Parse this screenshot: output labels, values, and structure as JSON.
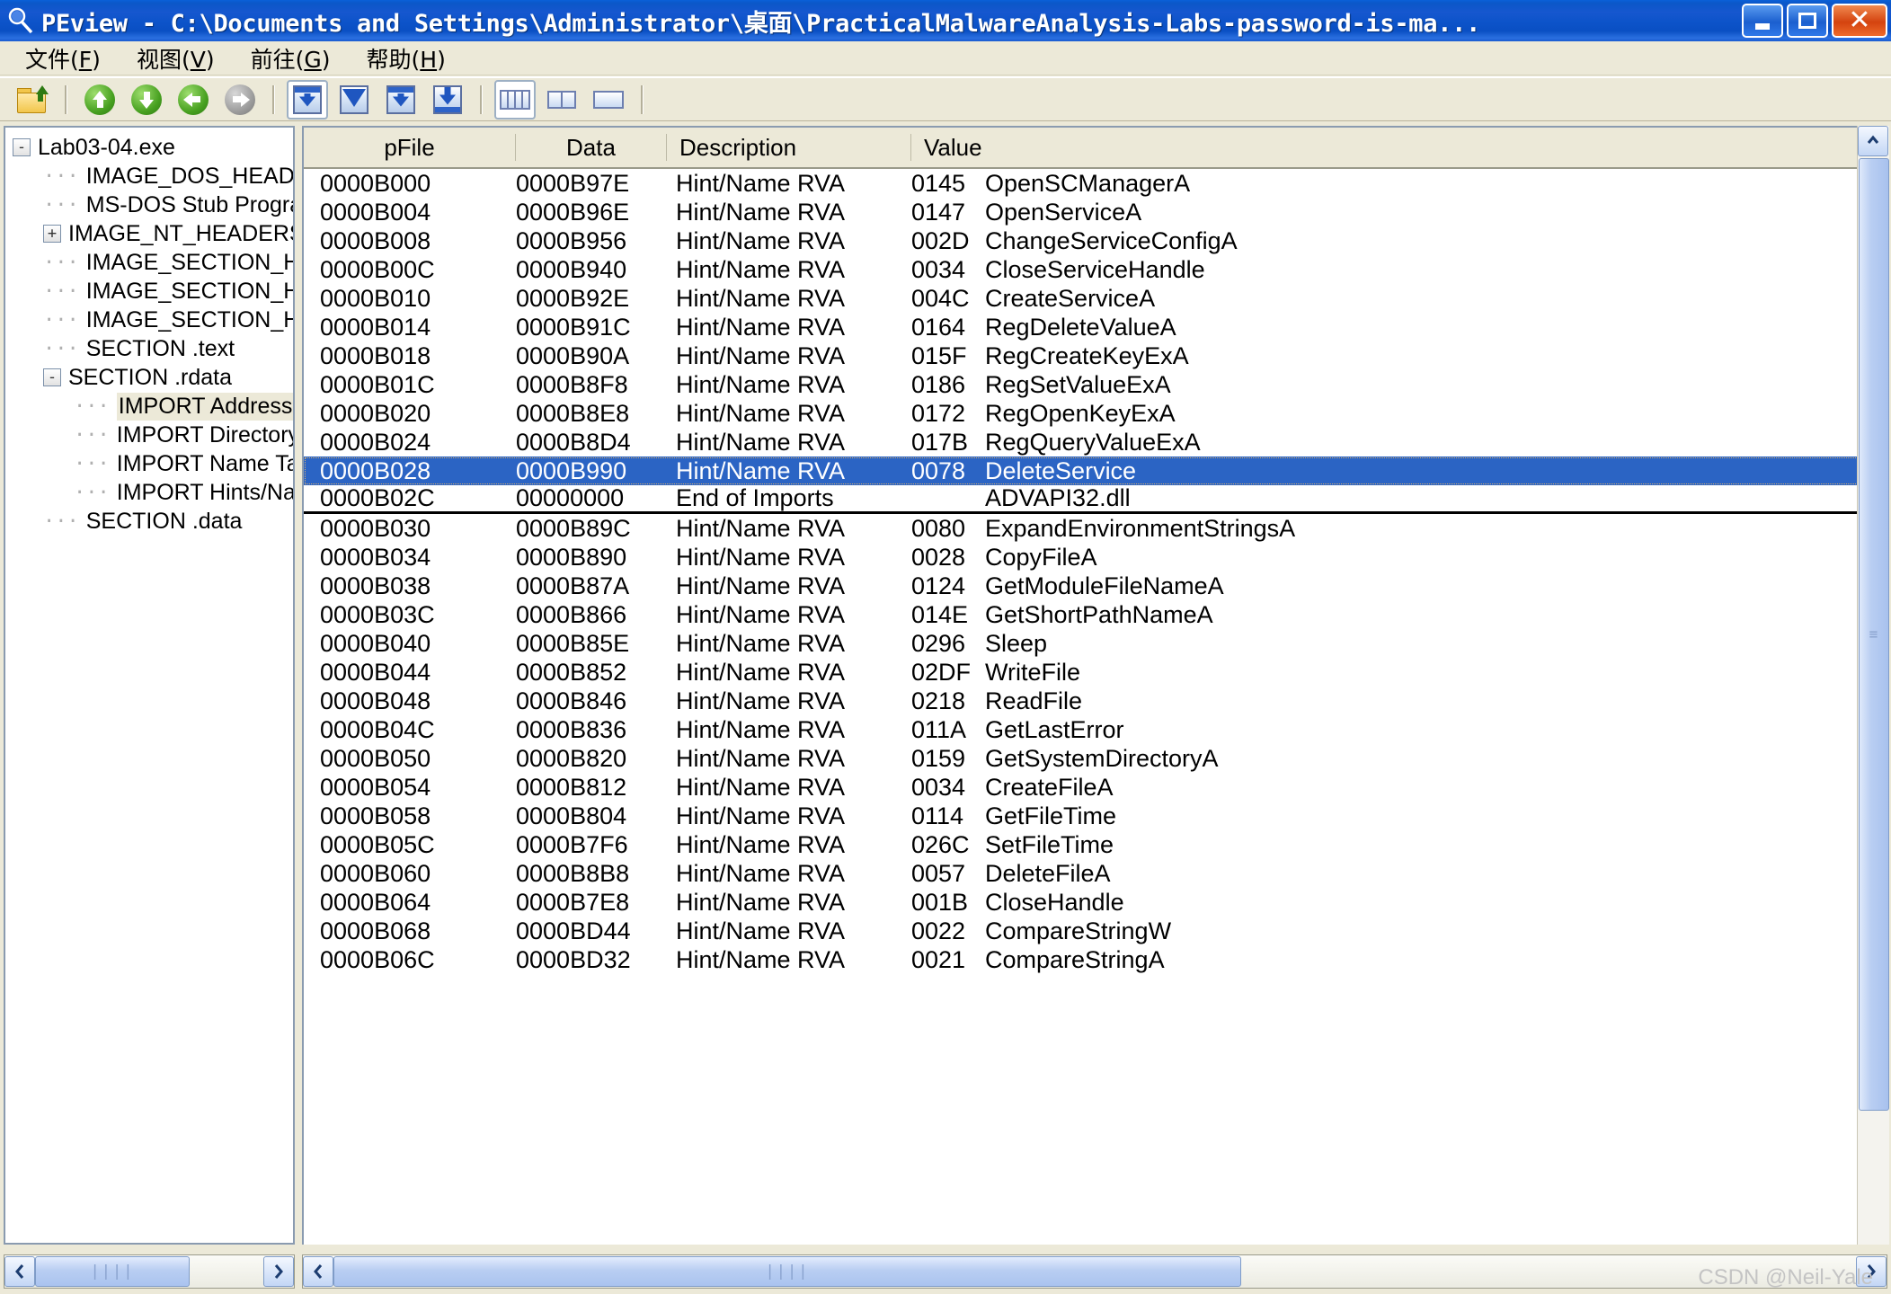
{
  "window": {
    "title": "PEview - C:\\Documents and Settings\\Administrator\\桌面\\PracticalMalwareAnalysis-Labs-password-is-ma...",
    "icon": "magnifier-icon",
    "buttons": {
      "minimize": "_",
      "maximize": "□",
      "close": "✕"
    }
  },
  "menu": {
    "items": [
      {
        "label": "文件",
        "mnemonic": "F"
      },
      {
        "label": "视图",
        "mnemonic": "V"
      },
      {
        "label": "前往",
        "mnemonic": "G"
      },
      {
        "label": "帮助",
        "mnemonic": "H"
      }
    ]
  },
  "toolbar": {
    "buttons": [
      {
        "name": "open-file-icon"
      },
      {
        "name": "go-up-icon"
      },
      {
        "name": "go-down-icon"
      },
      {
        "name": "go-back-icon"
      },
      {
        "name": "go-forward-icon"
      },
      {
        "name": "view-first-icon"
      },
      {
        "name": "view-next-icon"
      },
      {
        "name": "view-prev-icon"
      },
      {
        "name": "view-last-icon"
      },
      {
        "name": "layout-columns-icon"
      },
      {
        "name": "layout-two-pane-icon"
      },
      {
        "name": "layout-single-pane-icon"
      }
    ]
  },
  "tree": {
    "root": {
      "label": "Lab03-04.exe",
      "toggle": "-"
    },
    "items": [
      {
        "label": "IMAGE_DOS_HEADER",
        "toggle": "",
        "indent": 1,
        "selected": false
      },
      {
        "label": "MS-DOS Stub Program",
        "toggle": "",
        "indent": 1,
        "selected": false
      },
      {
        "label": "IMAGE_NT_HEADERS",
        "toggle": "+",
        "indent": 1,
        "selected": false
      },
      {
        "label": "IMAGE_SECTION_HEAI",
        "toggle": "",
        "indent": 1,
        "selected": false
      },
      {
        "label": "IMAGE_SECTION_HEAI",
        "toggle": "",
        "indent": 1,
        "selected": false
      },
      {
        "label": "IMAGE_SECTION_HEAI",
        "toggle": "",
        "indent": 1,
        "selected": false
      },
      {
        "label": "SECTION .text",
        "toggle": "",
        "indent": 1,
        "selected": false
      },
      {
        "label": "SECTION .rdata",
        "toggle": "-",
        "indent": 1,
        "selected": false
      },
      {
        "label": "IMPORT Address Tab",
        "toggle": "",
        "indent": 2,
        "selected": true
      },
      {
        "label": "IMPORT Directory Ta",
        "toggle": "",
        "indent": 2,
        "selected": false
      },
      {
        "label": "IMPORT Name Table",
        "toggle": "",
        "indent": 2,
        "selected": false
      },
      {
        "label": "IMPORT Hints/Name",
        "toggle": "",
        "indent": 2,
        "selected": false
      },
      {
        "label": "SECTION .data",
        "toggle": "",
        "indent": 1,
        "selected": false
      }
    ]
  },
  "table": {
    "columns": [
      "pFile",
      "Data",
      "Description",
      "Value"
    ],
    "rows": [
      {
        "pFile": "0000B000",
        "data": "0000B97E",
        "description": "Hint/Name RVA",
        "hint": "0145",
        "name": "OpenSCManagerA",
        "selected": false,
        "end": false
      },
      {
        "pFile": "0000B004",
        "data": "0000B96E",
        "description": "Hint/Name RVA",
        "hint": "0147",
        "name": "OpenServiceA",
        "selected": false,
        "end": false
      },
      {
        "pFile": "0000B008",
        "data": "0000B956",
        "description": "Hint/Name RVA",
        "hint": "002D",
        "name": "ChangeServiceConfigA",
        "selected": false,
        "end": false
      },
      {
        "pFile": "0000B00C",
        "data": "0000B940",
        "description": "Hint/Name RVA",
        "hint": "0034",
        "name": "CloseServiceHandle",
        "selected": false,
        "end": false
      },
      {
        "pFile": "0000B010",
        "data": "0000B92E",
        "description": "Hint/Name RVA",
        "hint": "004C",
        "name": "CreateServiceA",
        "selected": false,
        "end": false
      },
      {
        "pFile": "0000B014",
        "data": "0000B91C",
        "description": "Hint/Name RVA",
        "hint": "0164",
        "name": "RegDeleteValueA",
        "selected": false,
        "end": false
      },
      {
        "pFile": "0000B018",
        "data": "0000B90A",
        "description": "Hint/Name RVA",
        "hint": "015F",
        "name": "RegCreateKeyExA",
        "selected": false,
        "end": false
      },
      {
        "pFile": "0000B01C",
        "data": "0000B8F8",
        "description": "Hint/Name RVA",
        "hint": "0186",
        "name": "RegSetValueExA",
        "selected": false,
        "end": false
      },
      {
        "pFile": "0000B020",
        "data": "0000B8E8",
        "description": "Hint/Name RVA",
        "hint": "0172",
        "name": "RegOpenKeyExA",
        "selected": false,
        "end": false
      },
      {
        "pFile": "0000B024",
        "data": "0000B8D4",
        "description": "Hint/Name RVA",
        "hint": "017B",
        "name": "RegQueryValueExA",
        "selected": false,
        "end": false
      },
      {
        "pFile": "0000B028",
        "data": "0000B990",
        "description": "Hint/Name RVA",
        "hint": "0078",
        "name": "DeleteService",
        "selected": true,
        "end": false
      },
      {
        "pFile": "0000B02C",
        "data": "00000000",
        "description": "End of Imports",
        "hint": "",
        "name": "ADVAPI32.dll",
        "selected": false,
        "end": true
      },
      {
        "pFile": "0000B030",
        "data": "0000B89C",
        "description": "Hint/Name RVA",
        "hint": "0080",
        "name": "ExpandEnvironmentStringsA",
        "selected": false,
        "end": false
      },
      {
        "pFile": "0000B034",
        "data": "0000B890",
        "description": "Hint/Name RVA",
        "hint": "0028",
        "name": "CopyFileA",
        "selected": false,
        "end": false
      },
      {
        "pFile": "0000B038",
        "data": "0000B87A",
        "description": "Hint/Name RVA",
        "hint": "0124",
        "name": "GetModuleFileNameA",
        "selected": false,
        "end": false
      },
      {
        "pFile": "0000B03C",
        "data": "0000B866",
        "description": "Hint/Name RVA",
        "hint": "014E",
        "name": "GetShortPathNameA",
        "selected": false,
        "end": false
      },
      {
        "pFile": "0000B040",
        "data": "0000B85E",
        "description": "Hint/Name RVA",
        "hint": "0296",
        "name": "Sleep",
        "selected": false,
        "end": false
      },
      {
        "pFile": "0000B044",
        "data": "0000B852",
        "description": "Hint/Name RVA",
        "hint": "02DF",
        "name": "WriteFile",
        "selected": false,
        "end": false
      },
      {
        "pFile": "0000B048",
        "data": "0000B846",
        "description": "Hint/Name RVA",
        "hint": "0218",
        "name": "ReadFile",
        "selected": false,
        "end": false
      },
      {
        "pFile": "0000B04C",
        "data": "0000B836",
        "description": "Hint/Name RVA",
        "hint": "011A",
        "name": "GetLastError",
        "selected": false,
        "end": false
      },
      {
        "pFile": "0000B050",
        "data": "0000B820",
        "description": "Hint/Name RVA",
        "hint": "0159",
        "name": "GetSystemDirectoryA",
        "selected": false,
        "end": false
      },
      {
        "pFile": "0000B054",
        "data": "0000B812",
        "description": "Hint/Name RVA",
        "hint": "0034",
        "name": "CreateFileA",
        "selected": false,
        "end": false
      },
      {
        "pFile": "0000B058",
        "data": "0000B804",
        "description": "Hint/Name RVA",
        "hint": "0114",
        "name": "GetFileTime",
        "selected": false,
        "end": false
      },
      {
        "pFile": "0000B05C",
        "data": "0000B7F6",
        "description": "Hint/Name RVA",
        "hint": "026C",
        "name": "SetFileTime",
        "selected": false,
        "end": false
      },
      {
        "pFile": "0000B060",
        "data": "0000B8B8",
        "description": "Hint/Name RVA",
        "hint": "0057",
        "name": "DeleteFileA",
        "selected": false,
        "end": false
      },
      {
        "pFile": "0000B064",
        "data": "0000B7E8",
        "description": "Hint/Name RVA",
        "hint": "001B",
        "name": "CloseHandle",
        "selected": false,
        "end": false
      },
      {
        "pFile": "0000B068",
        "data": "0000BD44",
        "description": "Hint/Name RVA",
        "hint": "0022",
        "name": "CompareStringW",
        "selected": false,
        "end": false
      },
      {
        "pFile": "0000B06C",
        "data": "0000BD32",
        "description": "Hint/Name RVA",
        "hint": "0021",
        "name": "CompareStringA",
        "selected": false,
        "end": false
      }
    ]
  },
  "scrollbars": {
    "left_h": {
      "back": "‹",
      "forward": "›",
      "grip": "||||"
    },
    "right_h": {
      "back": "‹",
      "forward": "›",
      "grip": "||||"
    },
    "right_v": {
      "up": "▲",
      "down": "▼",
      "grip": "≡"
    }
  },
  "watermark": "CSDN @Neil-Yale"
}
